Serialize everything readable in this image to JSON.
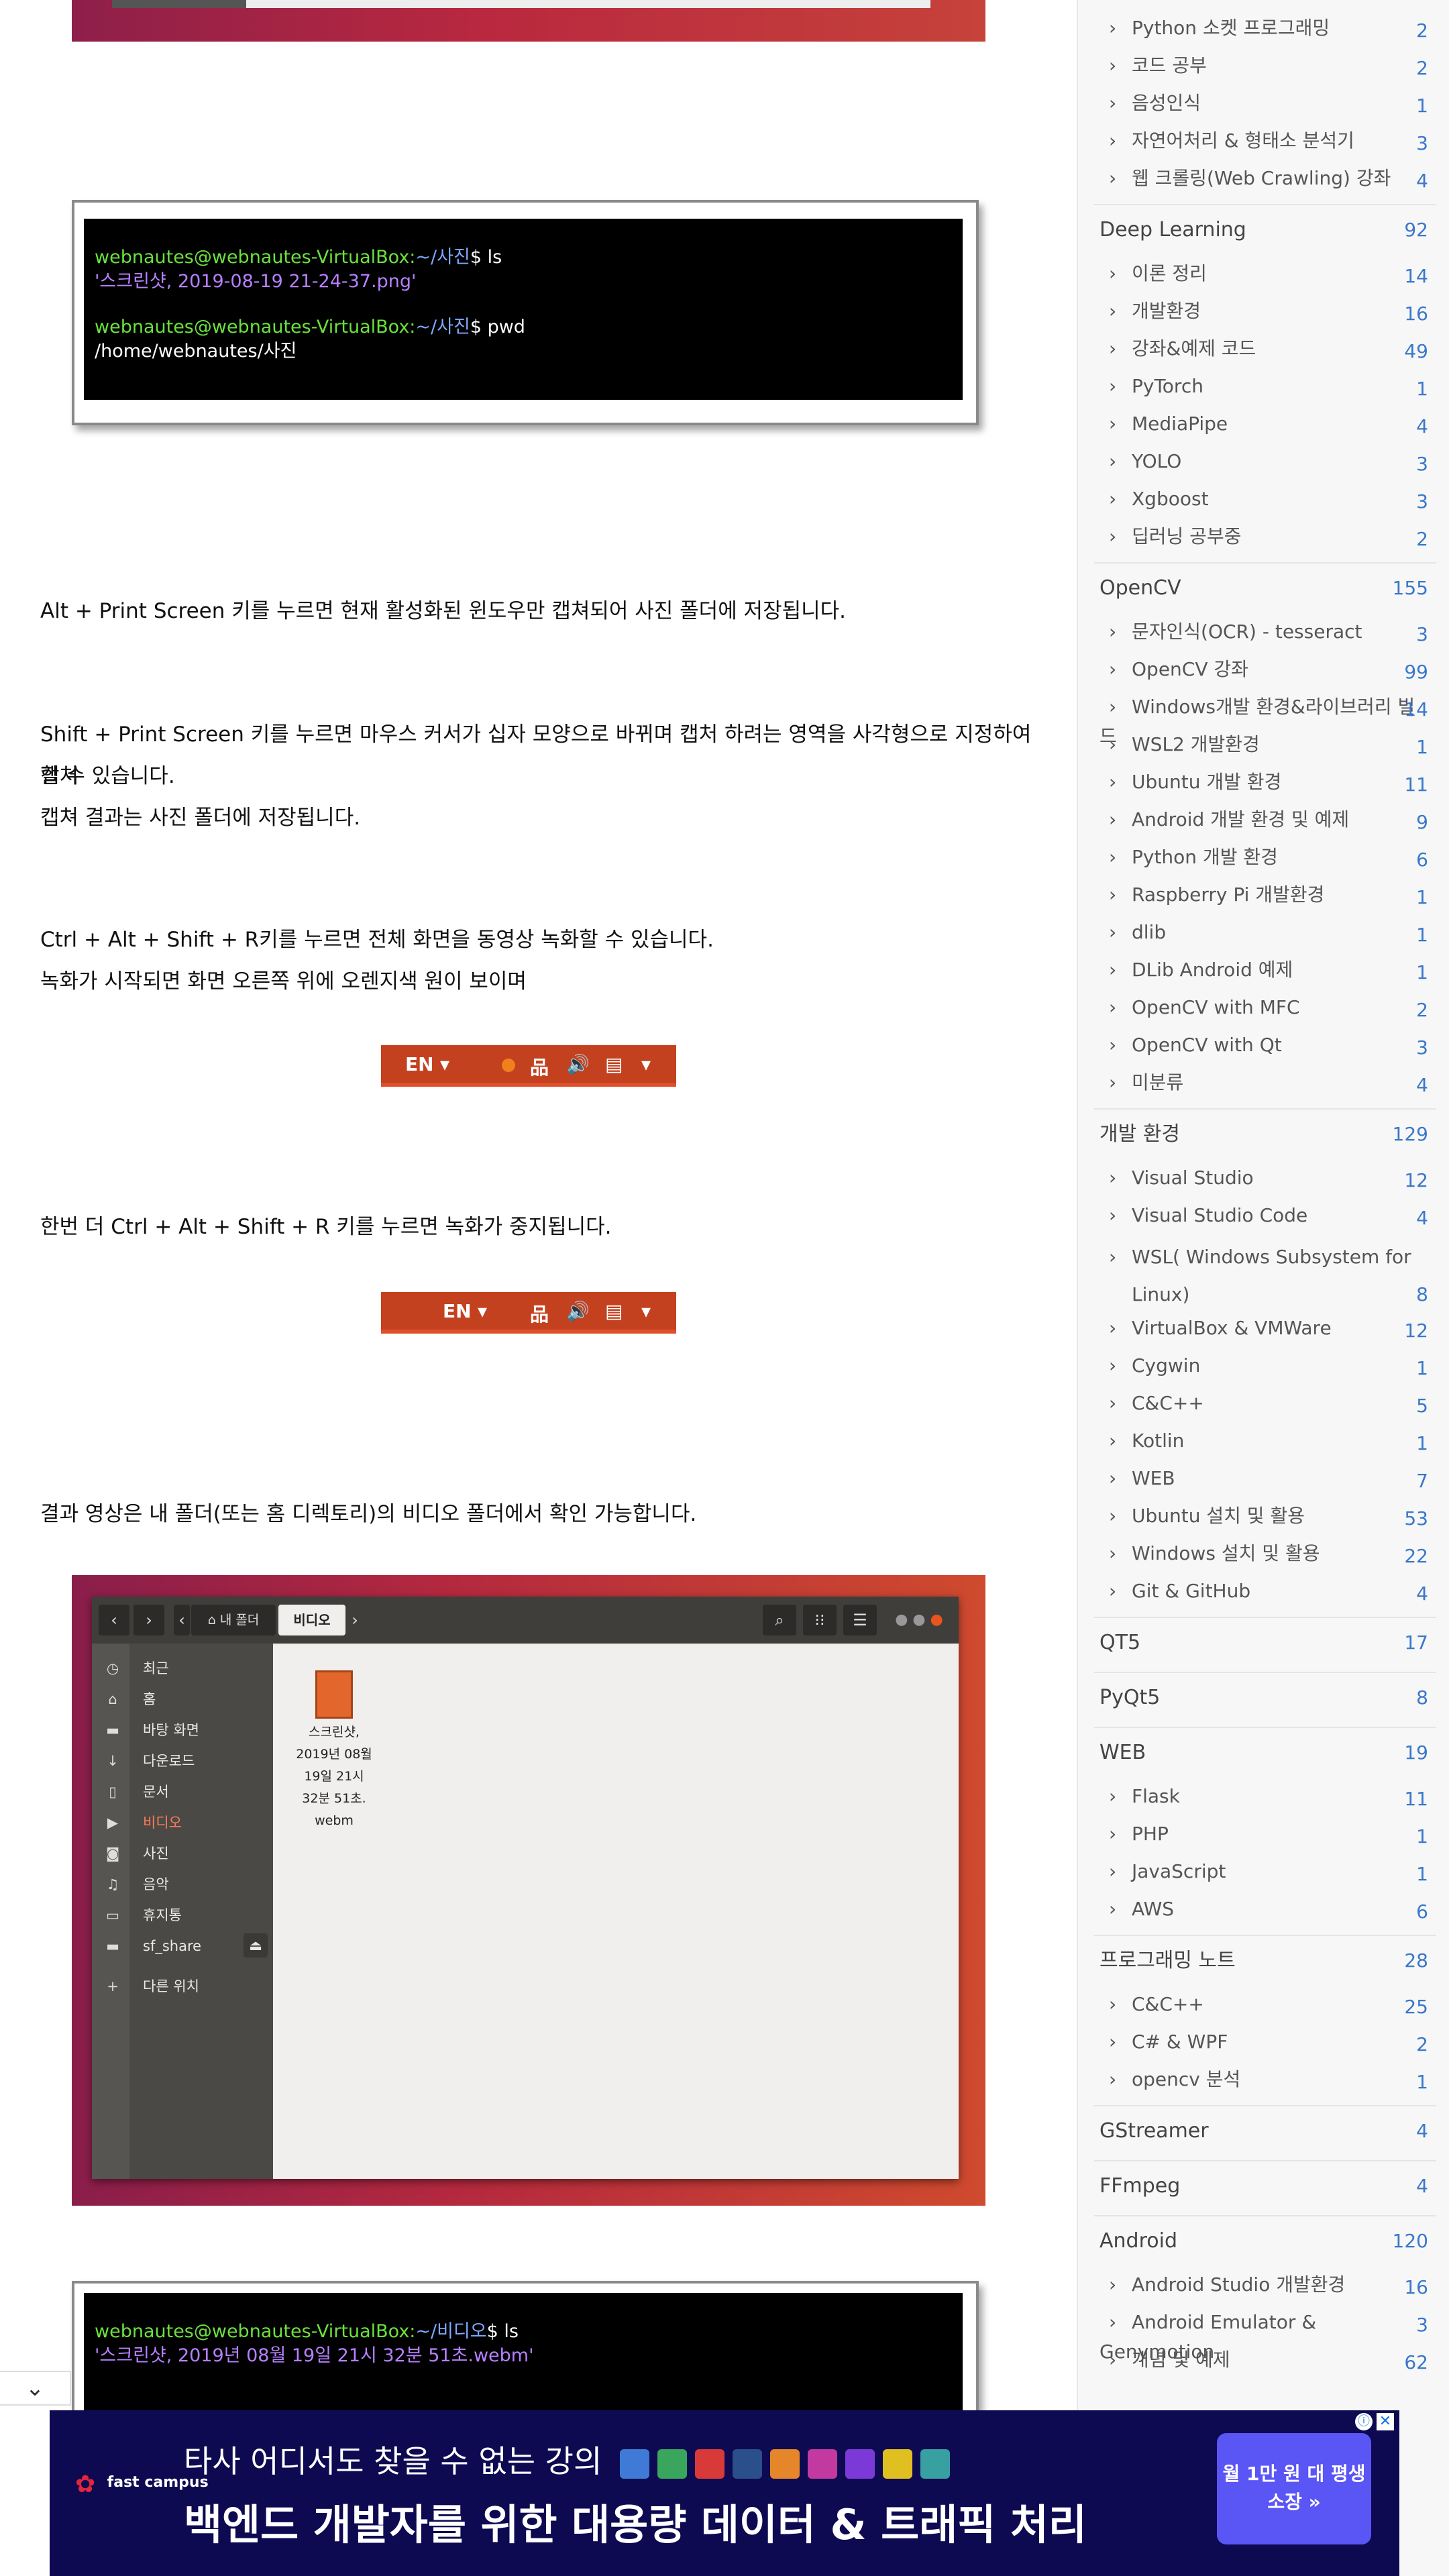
{
  "terminal1": {
    "line1_user": "webnautes@webnautes-VirtualBox:",
    "line1_path": "~/사진",
    "line1_cmd": "$ ls",
    "line2": "'스크린샷, 2019-08-19 21-24-37.png'",
    "line3_user": "webnautes@webnautes-VirtualBox:",
    "line3_path": "~/사진",
    "line3_cmd": "$ pwd",
    "line4": "/home/webnautes/사진"
  },
  "content": {
    "p1": "Alt + Print Screen 키를 누르면 현재 활성화된 윈도우만 캡쳐되어 사진 폴더에 저장됩니다.",
    "p2a": "Shift + Print Screen 키를 누르면 마우스 커서가 십자 모양으로 바뀌며  캡처 하려는 영역을 사각형으로 지정하여 캡처",
    "p2b": "할 수 있습니다.",
    "p2c": "캡쳐 결과는 사진 폴더에 저장됩니다.",
    "p3a": "Ctrl + Alt  + Shift + R키를 누르면 전체 화면을 동영상 녹화할 수 있습니다.",
    "p3b": "녹화가 시작되면 화면 오른쪽 위에 오렌지색 원이 보이며",
    "p4": "한번 더 Ctrl + Alt  + Shift + R 키를 누르면 녹화가 중지됩니다.",
    "p5": "결과 영상은 내 폴더(또는 홈 디렉토리)의 비디오 폴더에서 확인 가능합니다."
  },
  "topbar1": {
    "lang": "EN",
    "recording_color": "#f07f1d"
  },
  "topbar2": {
    "lang": "EN"
  },
  "file_manager": {
    "path_home": "내 폴더",
    "path_current": "비디오",
    "places": [
      {
        "icon": "clock-icon",
        "label": "최근"
      },
      {
        "icon": "home-icon",
        "label": "홈"
      },
      {
        "icon": "folder-icon",
        "label": "바탕 화면"
      },
      {
        "icon": "download-icon",
        "label": "다운로드"
      },
      {
        "icon": "document-icon",
        "label": "문서"
      },
      {
        "icon": "video-icon",
        "label": "비디오"
      },
      {
        "icon": "camera-icon",
        "label": "사진"
      },
      {
        "icon": "music-icon",
        "label": "음악"
      },
      {
        "icon": "trash-icon",
        "label": "휴지통"
      },
      {
        "icon": "drive-icon",
        "label": "sf_share"
      },
      {
        "icon": "plus-icon",
        "label": "다른 위치"
      }
    ],
    "file_name_lines": [
      "스크린샷,",
      "2019년 08월",
      "19일 21시",
      "32분 51초.",
      "webm"
    ]
  },
  "terminal2": {
    "line1_user": "webnautes@webnautes-VirtualBox:",
    "line1_path": "~/비디오",
    "line1_cmd": "$ ls",
    "line2": "'스크린샷, 2019년 08월 19일 21시 32분 51초.webm'"
  },
  "sidebar": {
    "items_top": [
      {
        "label": "Python 소켓 프로그래밍",
        "count": "2"
      },
      {
        "label": "코드 공부",
        "count": "2"
      },
      {
        "label": "음성인식",
        "count": "1"
      },
      {
        "label": "자연어처리 & 형태소 분석기",
        "count": "3"
      },
      {
        "label": "웹 크롤링(Web Crawling) 강좌",
        "count": "4"
      }
    ],
    "deep_learning": {
      "label": "Deep Learning",
      "count": "92"
    },
    "deep_learning_items": [
      {
        "label": "이론 정리",
        "count": "14"
      },
      {
        "label": "개발환경",
        "count": "16"
      },
      {
        "label": "강좌&예제 코드",
        "count": "49"
      },
      {
        "label": "PyTorch",
        "count": "1"
      },
      {
        "label": "MediaPipe",
        "count": "4"
      },
      {
        "label": "YOLO",
        "count": "3"
      },
      {
        "label": "Xgboost",
        "count": "3"
      },
      {
        "label": "딥러닝 공부중",
        "count": "2"
      }
    ],
    "opencv": {
      "label": "OpenCV",
      "count": "155"
    },
    "opencv_items": [
      {
        "label": "문자인식(OCR) - tesseract",
        "count": "3"
      },
      {
        "label": "OpenCV 강좌",
        "count": "99"
      },
      {
        "label": "Windows개발 환경&라이브러리 빌드",
        "count": "14"
      },
      {
        "label": "WSL2 개발환경",
        "count": "1"
      },
      {
        "label": "Ubuntu 개발 환경",
        "count": "11"
      },
      {
        "label": "Android 개발 환경 및 예제",
        "count": "9"
      },
      {
        "label": "Python 개발 환경",
        "count": "6"
      },
      {
        "label": "Raspberry Pi 개발환경",
        "count": "1"
      },
      {
        "label": "dlib",
        "count": "1"
      },
      {
        "label": "DLib Android 예제",
        "count": "1"
      },
      {
        "label": "OpenCV with MFC",
        "count": "2"
      },
      {
        "label": "OpenCV with Qt",
        "count": "3"
      },
      {
        "label": "미분류",
        "count": "4"
      }
    ],
    "devenv": {
      "label": "개발 환경",
      "count": "129"
    },
    "devenv_items": [
      {
        "label": "Visual Studio",
        "count": "12"
      },
      {
        "label": "Visual Studio Code",
        "count": "4"
      },
      {
        "label": "WSL( Windows Subsystem for",
        "label2": "Linux)",
        "count": "8"
      },
      {
        "label": "VirtualBox & VMWare",
        "count": "12"
      },
      {
        "label": "Cygwin",
        "count": "1"
      },
      {
        "label": "C&C++",
        "count": "5"
      },
      {
        "label": "Kotlin",
        "count": "1"
      },
      {
        "label": "WEB",
        "count": "7"
      },
      {
        "label": "Ubuntu 설치 및 활용",
        "count": "53"
      },
      {
        "label": "Windows 설치 및 활용",
        "count": "22"
      },
      {
        "label": "Git & GitHub",
        "count": "4"
      }
    ],
    "qt5": {
      "label": "QT5",
      "count": "17"
    },
    "pyqt5": {
      "label": "PyQt5",
      "count": "8"
    },
    "web": {
      "label": "WEB",
      "count": "19"
    },
    "web_items": [
      {
        "label": "Flask",
        "count": "11"
      },
      {
        "label": "PHP",
        "count": "1"
      },
      {
        "label": "JavaScript",
        "count": "1"
      },
      {
        "label": "AWS",
        "count": "6"
      }
    ],
    "prognote": {
      "label": "프로그래밍 노트",
      "count": "28"
    },
    "prognote_items": [
      {
        "label": "C&C++",
        "count": "25"
      },
      {
        "label": "C# & WPF",
        "count": "2"
      },
      {
        "label": "opencv 분석",
        "count": "1"
      }
    ],
    "gstreamer": {
      "label": "GStreamer",
      "count": "4"
    },
    "ffmpeg": {
      "label": "FFmpeg",
      "count": "4"
    },
    "android": {
      "label": "Android",
      "count": "120"
    },
    "android_items": [
      {
        "label": "Android Studio 개발환경",
        "count": "16"
      },
      {
        "label": "Android Emulator & Genymotion",
        "count": "3"
      },
      {
        "label": "개념 및 예제",
        "count": "62"
      }
    ]
  },
  "ad": {
    "logo_text": "fast campus",
    "line1": "타사 어디서도 찾을 수 없는 강의",
    "line2": "백엔드 개발자를 위한 대용량 데이터 & 트래픽 처리",
    "cta": "월 1만 원 대 평생 소장 »",
    "info": "ⓘ",
    "close": "✕"
  },
  "toggle_icon": "chevron-down-icon"
}
